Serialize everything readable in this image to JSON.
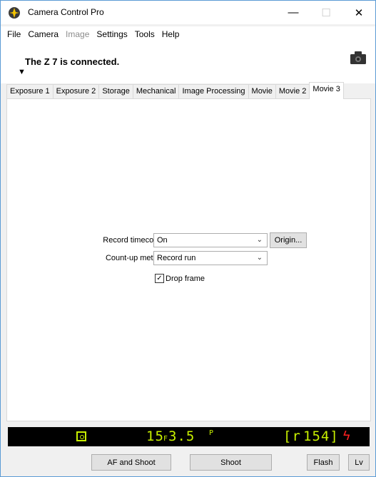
{
  "window": {
    "title": "Camera Control Pro",
    "minimize_glyph": "—",
    "maximize_glyph": "☐",
    "close_glyph": "✕"
  },
  "menu": [
    "File",
    "Camera",
    "Image",
    "Settings",
    "Tools",
    "Help"
  ],
  "menu_disabled": [
    "Image"
  ],
  "status": {
    "text": "The Z 7 is connected.",
    "arrow_glyph": "▼",
    "camera_icon": "camera-icon"
  },
  "tabs": [
    "Exposure 1",
    "Exposure 2",
    "Storage",
    "Mechanical",
    "Image Processing",
    "Movie",
    "Movie 2",
    "Movie 3"
  ],
  "active_tab": "Movie 3",
  "movie3": {
    "record_timecodes": {
      "label": "Record timecodes:",
      "value": "On"
    },
    "origin_button": "Origin...",
    "count_up_method": {
      "label": "Count-up method:",
      "value": "Record run"
    },
    "drop_frame": {
      "label": "Drop frame",
      "checked": true
    }
  },
  "lcd": {
    "shutter": "15",
    "f_label": "F",
    "aperture": "3.5",
    "mode": "P",
    "remaining_prefix": "[r",
    "remaining": "154]",
    "flash_glyph": "ϟ",
    "colors": {
      "background": "#000000",
      "segment": "#c8f000",
      "flash": "#ff2020"
    }
  },
  "bottom_buttons": {
    "af_and_shoot": "AF and Shoot",
    "shoot": "Shoot",
    "flash": "Flash",
    "lv": "Lv"
  }
}
